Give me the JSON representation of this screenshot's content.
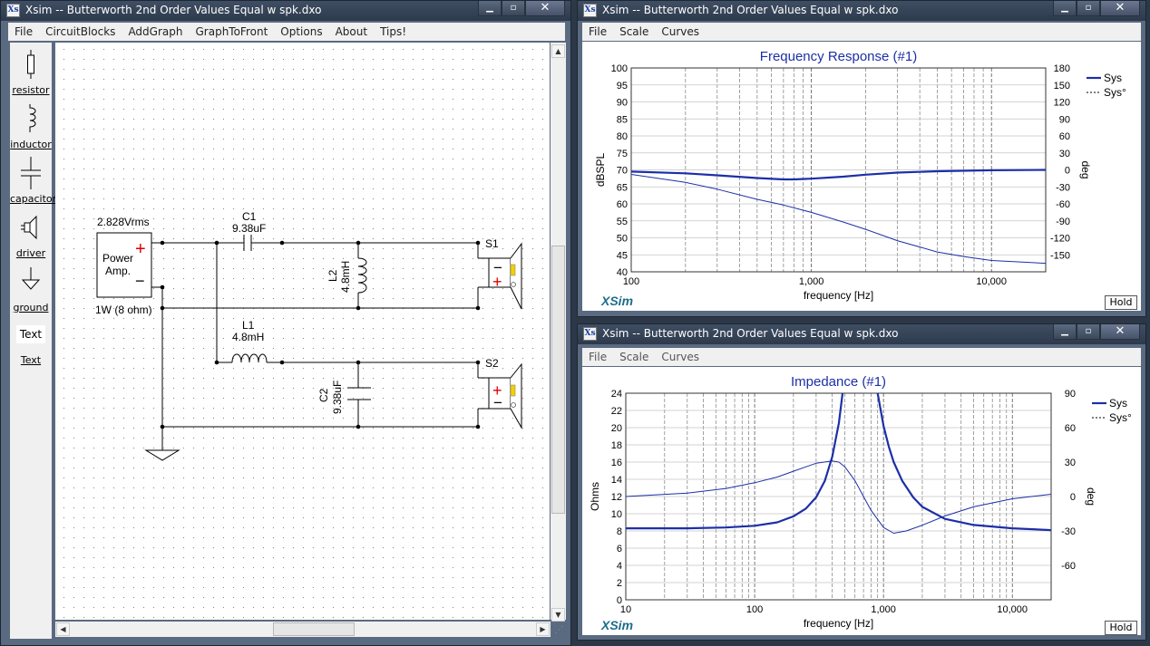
{
  "left_window": {
    "title": "Xsim -- Butterworth 2nd Order Values Equal w spk.dxo",
    "menu": [
      "File",
      "CircuitBlocks",
      "AddGraph",
      "GraphToFront",
      "Options",
      "About",
      "Tips!"
    ],
    "tools": [
      {
        "label": "resistor",
        "icon": "resistor-icon"
      },
      {
        "label": "inductor",
        "icon": "inductor-icon"
      },
      {
        "label": "capacitor",
        "icon": "capacitor-icon"
      },
      {
        "label": "driver",
        "icon": "speaker-icon"
      },
      {
        "label": "ground",
        "icon": "ground-icon"
      },
      {
        "label": "Text",
        "icon": "text-icon"
      }
    ],
    "schematic": {
      "source_voltage": "2.828Vrms",
      "amp_line1": "Power",
      "amp_line2": "Amp.",
      "amp_rating": "1W (8 ohm)",
      "plus": "+",
      "minus": "−",
      "c1_name": "C1",
      "c1_value": "9.38uF",
      "l2_name": "L2",
      "l2_value": "4.8mH",
      "l1_name": "L1",
      "l1_value": "4.8mH",
      "c2_name": "C2",
      "c2_value": "9.38uF",
      "s1_name": "S1",
      "s2_name": "S2"
    }
  },
  "freq_window": {
    "title": "Xsim -- Butterworth 2nd Order Values Equal w spk.dxo",
    "menu": [
      "File",
      "Scale",
      "Curves"
    ],
    "hold_label": "Hold",
    "watermark": "XSim",
    "chart_data": {
      "type": "line",
      "title": "Frequency Response (#1)",
      "xlabel": "frequency [Hz]",
      "ylabel": "dBSPL",
      "y2label": "deg",
      "xscale": "log",
      "xlim": [
        100,
        20000
      ],
      "ylim": [
        40,
        100
      ],
      "y2lim": [
        -180,
        180
      ],
      "xticks": [
        {
          "v": 100,
          "label": "100"
        },
        {
          "v": 1000,
          "label": "1,000"
        },
        {
          "v": 10000,
          "label": "10,000"
        }
      ],
      "yticks": [
        40,
        45,
        50,
        55,
        60,
        65,
        70,
        75,
        80,
        85,
        90,
        95,
        100
      ],
      "y2ticks": [
        -150,
        -120,
        -90,
        -60,
        -30,
        0,
        30,
        60,
        90,
        120,
        150,
        180
      ],
      "grid": true,
      "legend_position": "right",
      "series": [
        {
          "name": "Sys",
          "axis": "left",
          "style": "solid",
          "color": "#1c2fa8",
          "x": [
            100,
            200,
            300,
            500,
            700,
            800,
            1000,
            1500,
            2000,
            3000,
            5000,
            10000,
            20000
          ],
          "y": [
            69.5,
            69.0,
            68.4,
            67.6,
            67.2,
            67.2,
            67.4,
            68.0,
            68.6,
            69.2,
            69.6,
            69.9,
            70.0
          ]
        },
        {
          "name": "Sys°",
          "axis": "right",
          "style": "thin",
          "color": "#1c2fa8",
          "x": [
            100,
            200,
            300,
            500,
            700,
            1000,
            1500,
            2000,
            3000,
            5000,
            7000,
            10000,
            20000
          ],
          "y": [
            -8,
            -22,
            -34,
            -52,
            -62,
            -75,
            -92,
            -105,
            -125,
            -145,
            -153,
            -160,
            -165
          ]
        }
      ]
    }
  },
  "imp_window": {
    "title": "Xsim -- Butterworth 2nd Order Values Equal w spk.dxo",
    "menu": [
      "File",
      "Scale",
      "Curves"
    ],
    "hold_label": "Hold",
    "watermark": "XSim",
    "chart_data": {
      "type": "line",
      "title": "Impedance (#1)",
      "xlabel": "frequency [Hz]",
      "ylabel": "Ohms",
      "y2label": "deg",
      "xscale": "log",
      "xlim": [
        10,
        20000
      ],
      "ylim": [
        0,
        24
      ],
      "y2lim": [
        -90,
        90
      ],
      "xticks": [
        {
          "v": 10,
          "label": "10"
        },
        {
          "v": 100,
          "label": "100"
        },
        {
          "v": 1000,
          "label": "1,000"
        },
        {
          "v": 10000,
          "label": "10,000"
        }
      ],
      "yticks": [
        0,
        2,
        4,
        6,
        8,
        10,
        12,
        14,
        16,
        18,
        20,
        22,
        24
      ],
      "y2ticks": [
        -60,
        -30,
        0,
        30,
        60,
        90
      ],
      "grid": true,
      "legend_position": "right",
      "series": [
        {
          "name": "Sys",
          "axis": "left",
          "style": "solid",
          "color": "#1c2fa8",
          "x": [
            10,
            30,
            60,
            100,
            150,
            200,
            250,
            300,
            350,
            400,
            450,
            500,
            550,
            600,
            800,
            900,
            1000,
            1100,
            1200,
            1400,
            1700,
            2000,
            3000,
            5000,
            10000,
            20000
          ],
          "y": [
            8.3,
            8.3,
            8.4,
            8.6,
            9.0,
            9.7,
            10.6,
            11.9,
            13.8,
            16.6,
            20.5,
            26,
            34,
            34,
            30,
            24,
            20.2,
            17.8,
            16.0,
            13.8,
            11.9,
            10.8,
            9.4,
            8.7,
            8.3,
            8.1
          ]
        },
        {
          "name": "Sys°",
          "axis": "right",
          "style": "thin",
          "color": "#1c2fa8",
          "x": [
            10,
            30,
            60,
            100,
            150,
            200,
            300,
            400,
            450,
            500,
            600,
            700,
            800,
            1000,
            1200,
            1500,
            2000,
            3000,
            5000,
            10000,
            20000
          ],
          "y": [
            0,
            3,
            7,
            12,
            17,
            22,
            29,
            31,
            30,
            26,
            14,
            0,
            -12,
            -27,
            -32,
            -30,
            -25,
            -17,
            -9,
            -2,
            2
          ]
        }
      ]
    }
  }
}
